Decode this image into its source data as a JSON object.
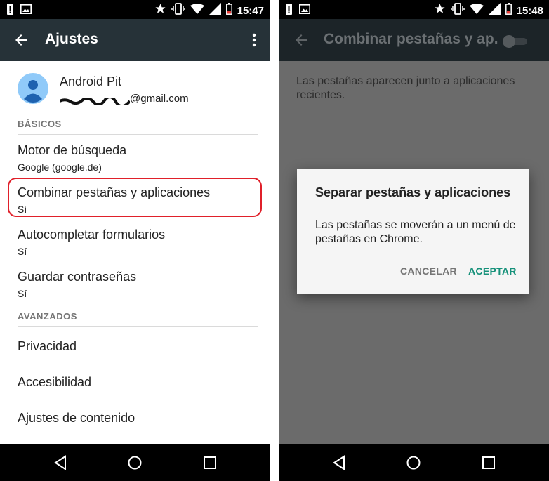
{
  "left": {
    "status": {
      "time": "15:47"
    },
    "appbar": {
      "title": "Ajustes"
    },
    "account": {
      "name": "Android Pit",
      "email_suffix": "@gmail.com"
    },
    "sections": {
      "basicos": "BÁSICOS",
      "avanzados": "AVANZADOS"
    },
    "items": [
      {
        "title": "Motor de búsqueda",
        "subtitle": "Google (google.de)"
      },
      {
        "title": "Combinar pestañas y aplicaciones",
        "subtitle": "Sí"
      },
      {
        "title": "Autocompletar formularios",
        "subtitle": "Sí"
      },
      {
        "title": "Guardar contraseñas",
        "subtitle": "Sí"
      }
    ],
    "advanced_items": [
      {
        "title": "Privacidad"
      },
      {
        "title": "Accesibilidad"
      },
      {
        "title": "Ajustes de contenido"
      }
    ]
  },
  "right": {
    "status": {
      "time": "15:48"
    },
    "appbar": {
      "title": "Combinar pestañas y ap..."
    },
    "description": "Las pestañas aparecen junto a aplicaciones recientes.",
    "dialog": {
      "title": "Separar pestañas y aplicaciones",
      "body": "Las pestañas se moverán a un menú de pestañas en Chrome.",
      "cancel": "CANCELAR",
      "accept": "ACEPTAR"
    }
  },
  "colors": {
    "appbar": "#263238",
    "accent": "#16917a",
    "highlight": "#e0202a",
    "dim_overlay": "#6b6b6b"
  }
}
